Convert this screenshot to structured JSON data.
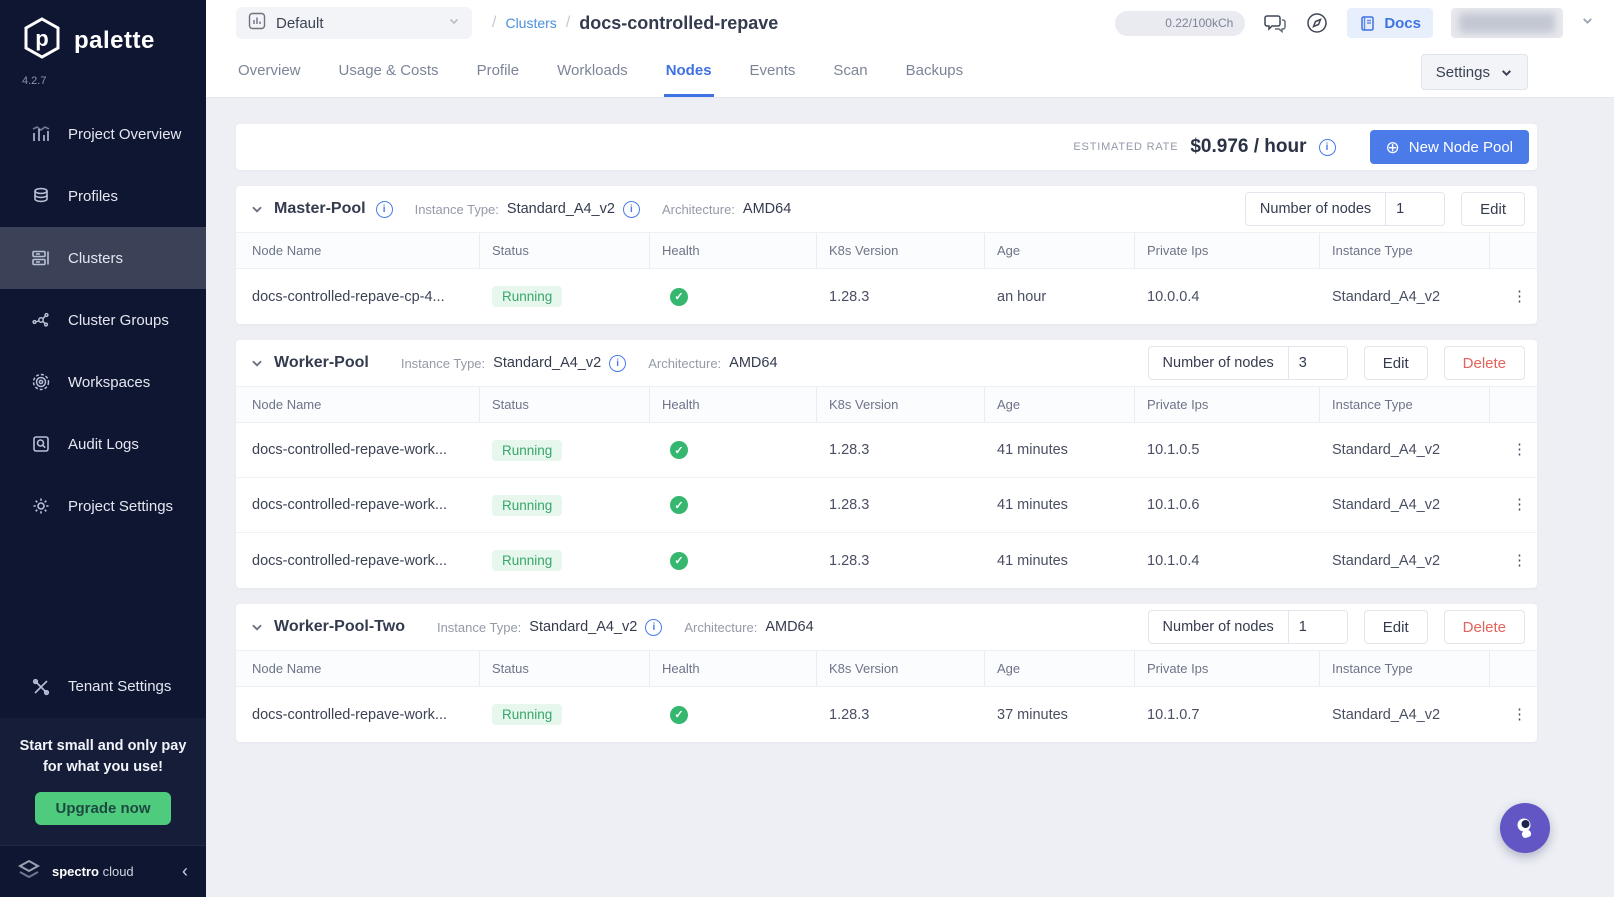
{
  "app": {
    "name": "palette",
    "version": "4.2.7"
  },
  "colors": {
    "accent_blue": "#4a7be9",
    "sidebar_bg": "#0f1631",
    "active_item_bg": "#3b4258",
    "status_green": "#36b770",
    "status_badge_bg": "#e7f7ee",
    "delete_red": "#e0635c",
    "upgrade_green": "#4ecb7d",
    "content_bg": "#edeff5",
    "fab_purple": "#6156c4"
  },
  "sidebar": {
    "items": [
      {
        "label": "Project Overview",
        "icon": "bar-chart-icon"
      },
      {
        "label": "Profiles",
        "icon": "layers-icon"
      },
      {
        "label": "Clusters",
        "icon": "clusters-icon"
      },
      {
        "label": "Cluster Groups",
        "icon": "network-icon"
      },
      {
        "label": "Workspaces",
        "icon": "workspaces-icon"
      },
      {
        "label": "Audit Logs",
        "icon": "audit-log-icon"
      },
      {
        "label": "Project Settings",
        "icon": "gear-icon"
      },
      {
        "label": "Tenant Settings",
        "icon": "tools-icon"
      }
    ],
    "active_item": "Clusters",
    "promo": {
      "line1": "Start small and only pay",
      "line2": "for what you use!",
      "button": "Upgrade now"
    },
    "brand": {
      "bold": "spectro",
      "light": " cloud"
    },
    "collapse_icon": "‹"
  },
  "header": {
    "project_selector": "Default",
    "breadcrumb": {
      "separator": "/",
      "link": "Clusters",
      "current": "docs-controlled-repave"
    },
    "usage_meter": "0.22/100kCh",
    "docs_button": "Docs"
  },
  "tabs": {
    "items": [
      "Overview",
      "Usage & Costs",
      "Profile",
      "Workloads",
      "Nodes",
      "Events",
      "Scan",
      "Backups"
    ],
    "active": "Nodes",
    "settings_button": "Settings"
  },
  "rate_bar": {
    "label": "ESTIMATED RATE",
    "value": "$0.976 / hour",
    "new_node_pool_button": "New Node Pool"
  },
  "pool_common": {
    "instance_type_label": "Instance Type:",
    "architecture_label": "Architecture:",
    "nodes_label": "Number of nodes",
    "edit": "Edit",
    "delete": "Delete"
  },
  "table": {
    "headers": [
      "Node Name",
      "Status",
      "Health",
      "K8s Version",
      "Age",
      "Private Ips",
      "Instance Type"
    ]
  },
  "pools": [
    {
      "name": "Master-Pool",
      "instance_type": "Standard_A4_v2",
      "architecture": "AMD64",
      "nodes_count": "1",
      "rows": [
        {
          "name": "docs-controlled-repave-cp-4...",
          "status": "Running",
          "k8s_version": "1.28.3",
          "age": "an hour",
          "private_ip": "10.0.0.4",
          "instance_type": "Standard_A4_v2"
        }
      ]
    },
    {
      "name": "Worker-Pool",
      "instance_type": "Standard_A4_v2",
      "architecture": "AMD64",
      "nodes_count": "3",
      "rows": [
        {
          "name": "docs-controlled-repave-work...",
          "status": "Running",
          "k8s_version": "1.28.3",
          "age": "41 minutes",
          "private_ip": "10.1.0.5",
          "instance_type": "Standard_A4_v2"
        },
        {
          "name": "docs-controlled-repave-work...",
          "status": "Running",
          "k8s_version": "1.28.3",
          "age": "41 minutes",
          "private_ip": "10.1.0.6",
          "instance_type": "Standard_A4_v2"
        },
        {
          "name": "docs-controlled-repave-work...",
          "status": "Running",
          "k8s_version": "1.28.3",
          "age": "41 minutes",
          "private_ip": "10.1.0.4",
          "instance_type": "Standard_A4_v2"
        }
      ]
    },
    {
      "name": "Worker-Pool-Two",
      "instance_type": "Standard_A4_v2",
      "architecture": "AMD64",
      "nodes_count": "1",
      "rows": [
        {
          "name": "docs-controlled-repave-work...",
          "status": "Running",
          "k8s_version": "1.28.3",
          "age": "37 minutes",
          "private_ip": "10.1.0.7",
          "instance_type": "Standard_A4_v2"
        }
      ]
    }
  ]
}
